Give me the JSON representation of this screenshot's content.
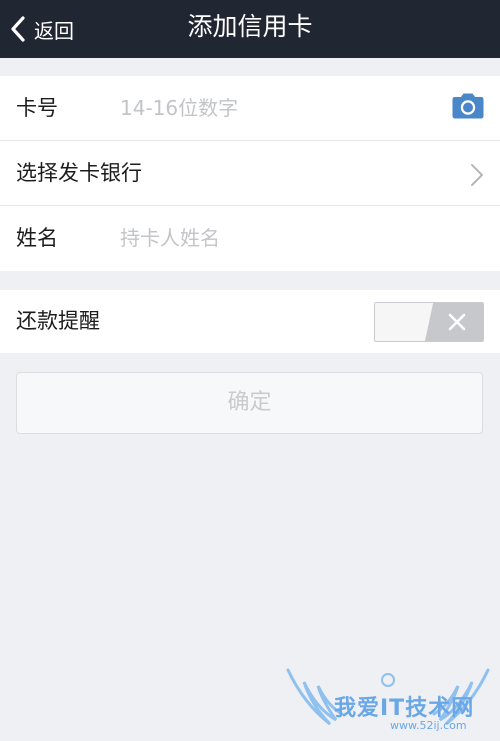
{
  "navbar": {
    "back_label": "返回",
    "title": "添加信用卡"
  },
  "form": {
    "card_number": {
      "label": "卡号",
      "value": "",
      "placeholder": "14-16位数字",
      "icon": "camera-icon"
    },
    "bank": {
      "label": "选择发卡银行",
      "icon": "chevron-right-icon"
    },
    "name": {
      "label": "姓名",
      "value": "",
      "placeholder": "持卡人姓名"
    }
  },
  "reminder": {
    "label": "还款提醒",
    "enabled": false
  },
  "confirm_label": "确定",
  "watermark": {
    "text": "我爱IT技术网",
    "url": "www.52ij.com"
  },
  "colors": {
    "navbar_bg": "#212732",
    "page_bg": "#eef0f4",
    "accent": "#4a87c8",
    "placeholder": "#c2c4c8",
    "watermark": "#6aa7e6"
  }
}
